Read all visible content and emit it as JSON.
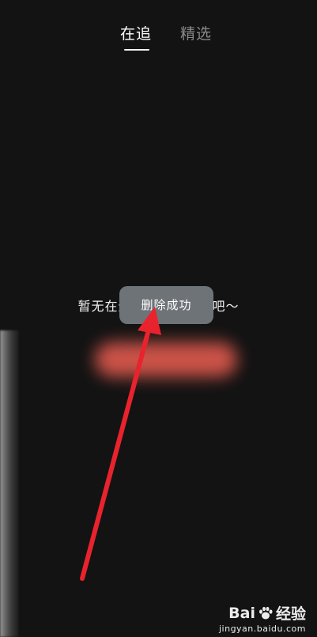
{
  "tabs": [
    {
      "label": "在追",
      "active": true
    },
    {
      "label": "精选",
      "active": false
    }
  ],
  "empty_state": {
    "text": "暂无在追，快去追几部吧～"
  },
  "toast": {
    "text": "删除成功"
  },
  "watermark": {
    "logo_text": "Bai",
    "logo_suffix": "经验",
    "url": "jingyan.baidu.com"
  },
  "colors": {
    "background": "#131313",
    "tab_active": "#ffffff",
    "tab_inactive": "#8a8a8a",
    "toast_bg": "#6e7378",
    "arrow": "#e8232d"
  }
}
